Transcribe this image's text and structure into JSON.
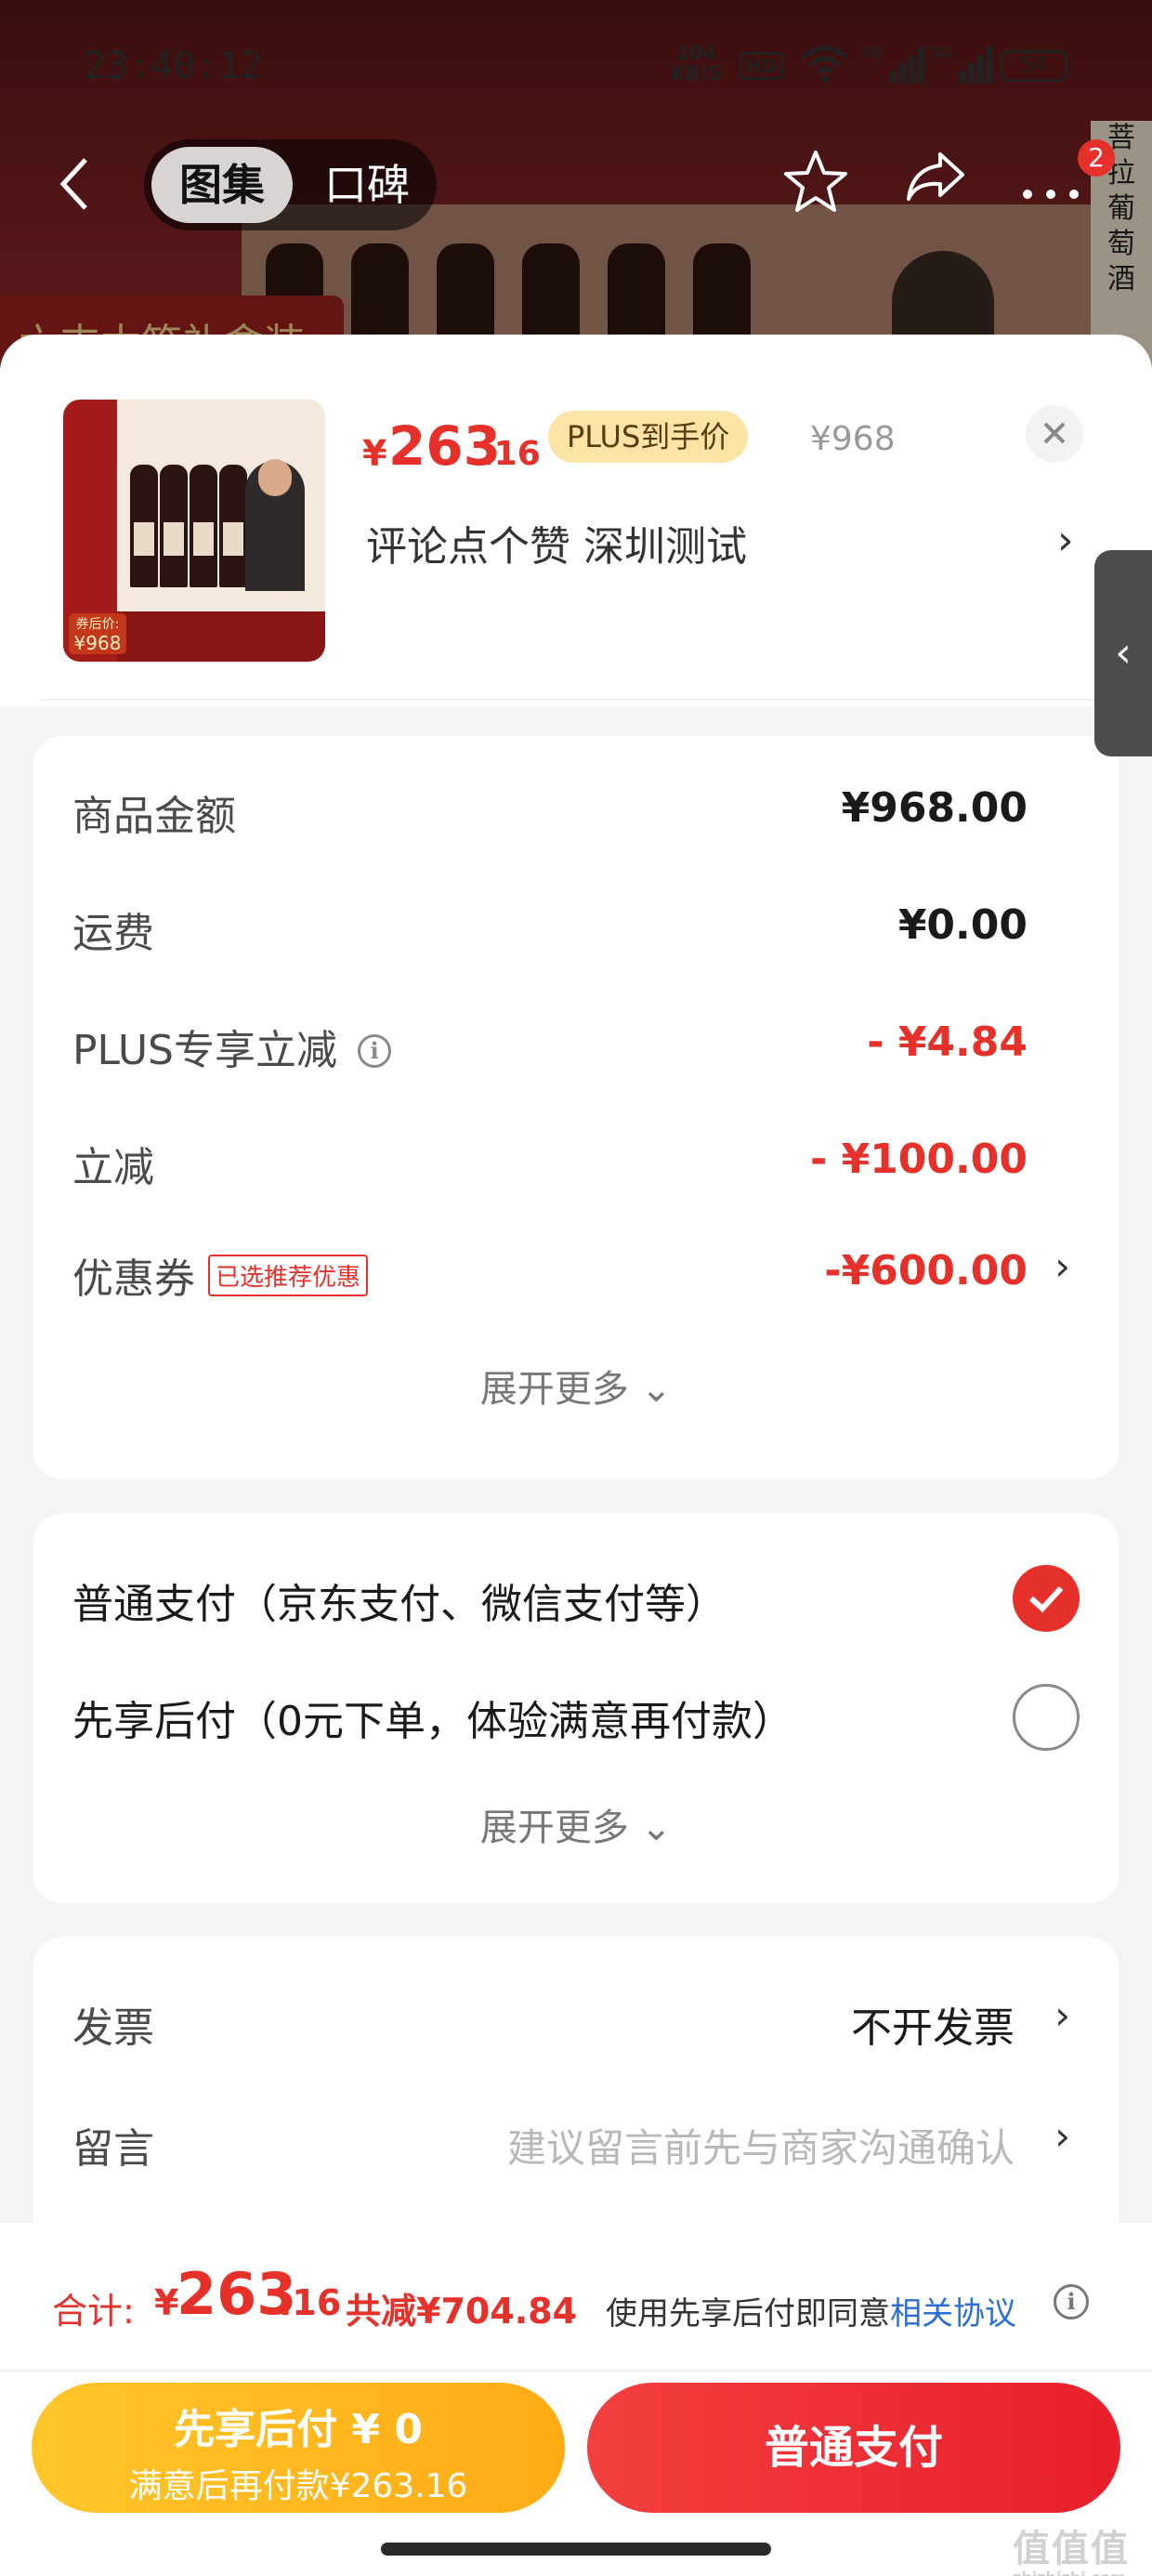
{
  "status_bar": {
    "time": "23:40:12",
    "net_speed_value": "104",
    "net_speed_unit": "KB/S",
    "hd": "HD",
    "sig1": "5G",
    "sig2": "5G",
    "battery": "54"
  },
  "top_nav": {
    "tabs": [
      {
        "label": "图集",
        "active": true
      },
      {
        "label": "口碑",
        "active": false
      }
    ],
    "badge_count": "2"
  },
  "background": {
    "banner_text": "六支木箱礼盒装",
    "side_text": [
      "菩",
      "拉",
      "葡",
      "萄",
      "酒"
    ]
  },
  "product": {
    "price_symbol": "¥",
    "price_int": "263",
    "price_dec": ".16",
    "plus_badge": "PLUS到手价",
    "original_price": "¥968",
    "spec": "评论点个赞  深圳测试",
    "thumb_price_label": "券后价:",
    "thumb_price": "¥968"
  },
  "amounts": {
    "rows": [
      {
        "label": "商品金额",
        "value": "¥968.00",
        "red": false
      },
      {
        "label": "运费",
        "value": "¥0.00",
        "red": false
      },
      {
        "label": "PLUS专享立减",
        "value": "- ¥4.84",
        "red": true
      },
      {
        "label": "立减",
        "value": "- ¥100.00",
        "red": true
      },
      {
        "label": "优惠券",
        "tag": "已选推荐优惠",
        "value": "-¥600.00",
        "red": true
      }
    ],
    "expand_label": "展开更多"
  },
  "payment": {
    "options": [
      {
        "label": "普通支付（京东支付、微信支付等）",
        "selected": true
      },
      {
        "label": "先享后付（0元下单，体验满意再付款）",
        "selected": false
      }
    ],
    "expand_label": "展开更多"
  },
  "invoice": {
    "invoice_label": "发票",
    "invoice_value": "不开发票",
    "message_label": "留言",
    "message_placeholder": "建议留言前先与商家沟通确认"
  },
  "bottom": {
    "total_label": "合计:",
    "total_symbol": "¥",
    "total_int": "263",
    "total_dec": ".16",
    "saved": "共减¥704.84",
    "agree_text": "使用先享后付即同意",
    "agree_link": "相关协议",
    "btn_later_title": "先享后付 ¥ 0",
    "btn_later_sub": "满意后再付款¥263.16",
    "btn_normal": "普通支付",
    "watermark": "值值值",
    "watermark_sub": "zhizhizhi.com"
  },
  "colors": {
    "accent_red": "#e5312a",
    "plus_gold": "#fbe4a6",
    "later_yellow": "#ffb81f",
    "link_blue": "#2a6fd6"
  },
  "icons": [
    "back-arrow-icon",
    "star-icon",
    "share-icon",
    "more-icon",
    "close-icon",
    "chevron-right-icon",
    "chevron-left-icon",
    "info-icon",
    "checkmark-icon",
    "chevron-down-icon",
    "wifi-icon",
    "signal-icon",
    "battery-icon"
  ]
}
